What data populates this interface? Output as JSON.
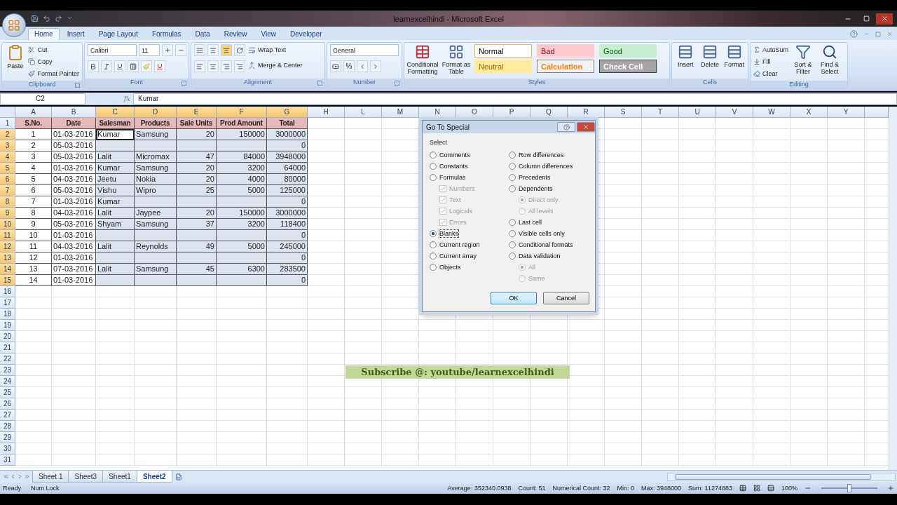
{
  "window": {
    "title": "learnexcelhindi - Microsoft Excel"
  },
  "ribbon_tabs": [
    {
      "label": "Home",
      "selected": true
    },
    {
      "label": "Insert",
      "selected": false
    },
    {
      "label": "Page Layout",
      "selected": false
    },
    {
      "label": "Formulas",
      "selected": false
    },
    {
      "label": "Data",
      "selected": false
    },
    {
      "label": "Review",
      "selected": false
    },
    {
      "label": "View",
      "selected": false
    },
    {
      "label": "Developer",
      "selected": false
    }
  ],
  "clipboard": {
    "title": "Clipboard",
    "paste": "Paste",
    "items": [
      "Cut",
      "Copy",
      "Format Painter"
    ]
  },
  "font": {
    "title": "Font",
    "font_name": "Calibri",
    "font_size": "11"
  },
  "alignment": {
    "title": "Alignment",
    "wrap": "Wrap Text",
    "merge": "Merge & Center"
  },
  "number": {
    "title": "Number",
    "format": "General",
    "percent": "%"
  },
  "styles": {
    "title": "Styles",
    "buttons": [
      "Conditional Formatting",
      "Format as Table"
    ],
    "gallery": [
      {
        "label": "Normal",
        "kind": "normal"
      },
      {
        "label": "Bad",
        "kind": "bad"
      },
      {
        "label": "Good",
        "kind": "good"
      },
      {
        "label": "Neutral",
        "kind": "neutral"
      },
      {
        "label": "Calculation",
        "kind": "calculation"
      },
      {
        "label": "Check Cell",
        "kind": "check"
      }
    ]
  },
  "cells": {
    "title": "Cells",
    "buttons": [
      "Insert",
      "Delete",
      "Format"
    ]
  },
  "editing": {
    "title": "Editing",
    "items": [
      "AutoSum",
      "Fill",
      "Clear"
    ],
    "buttons": [
      "Sort & Filter",
      "Find & Select"
    ]
  },
  "formula_bar": {
    "name_box": "C2",
    "function_label": "fx",
    "formula": "Kumar"
  },
  "columns": [
    {
      "label": "A",
      "selected": false
    },
    {
      "label": "B",
      "selected": false
    },
    {
      "label": "C",
      "selected": true
    },
    {
      "label": "D",
      "selected": true
    },
    {
      "label": "E",
      "selected": true
    },
    {
      "label": "F",
      "selected": true
    },
    {
      "label": "G",
      "selected": true
    },
    {
      "label": "H",
      "selected": false
    },
    {
      "label": "L",
      "selected": false
    },
    {
      "label": "M",
      "selected": false
    },
    {
      "label": "N",
      "selected": false
    },
    {
      "label": "O",
      "selected": false
    },
    {
      "label": "P",
      "selected": false
    },
    {
      "label": "Q",
      "selected": false
    },
    {
      "label": "R",
      "selected": false
    },
    {
      "label": "S",
      "selected": false
    },
    {
      "label": "T",
      "selected": false
    },
    {
      "label": "U",
      "selected": false
    },
    {
      "label": "V",
      "selected": false
    },
    {
      "label": "W",
      "selected": false
    },
    {
      "label": "X",
      "selected": false
    },
    {
      "label": "Y",
      "selected": false
    }
  ],
  "rows": [
    {
      "number": "1",
      "kind": "header",
      "selected": false,
      "cells": {
        "A": "S.No.",
        "B": "Date",
        "C": "Salesman",
        "D": "Products",
        "E": "Sale Units",
        "F": "Prod Amount",
        "G": "Total"
      }
    },
    {
      "number": "2",
      "kind": "data",
      "selected": true,
      "cells": {
        "A": "1",
        "B": "01-03-2016",
        "C": "Kumar",
        "D": "Samsung",
        "E": "20",
        "F": "150000",
        "G": "3000000"
      }
    },
    {
      "number": "3",
      "kind": "data",
      "selected": true,
      "cells": {
        "A": "2",
        "B": "05-03-2016",
        "G": "0"
      }
    },
    {
      "number": "4",
      "kind": "data",
      "selected": true,
      "cells": {
        "A": "3",
        "B": "05-03-2016",
        "C": "Lalit",
        "D": "Micromax",
        "E": "47",
        "F": "84000",
        "G": "3948000"
      }
    },
    {
      "number": "5",
      "kind": "data",
      "selected": true,
      "cells": {
        "A": "4",
        "B": "01-03-2016",
        "C": "Kumar",
        "D": "Samsung",
        "E": "20",
        "F": "3200",
        "G": "64000"
      }
    },
    {
      "number": "6",
      "kind": "data",
      "selected": true,
      "cells": {
        "A": "5",
        "B": "04-03-2016",
        "C": "Jeetu",
        "D": "Nokia",
        "E": "20",
        "F": "4000",
        "G": "80000"
      }
    },
    {
      "number": "7",
      "kind": "data",
      "selected": true,
      "cells": {
        "A": "6",
        "B": "05-03-2016",
        "C": "Vishu",
        "D": "Wipro",
        "E": "25",
        "F": "5000",
        "G": "125000"
      }
    },
    {
      "number": "8",
      "kind": "data",
      "selected": true,
      "cells": {
        "A": "7",
        "B": "01-03-2016",
        "C": "Kumar",
        "G": "0"
      }
    },
    {
      "number": "9",
      "kind": "data",
      "selected": true,
      "cells": {
        "A": "8",
        "B": "04-03-2016",
        "C": "Lalit",
        "D": "Jaypee",
        "E": "20",
        "F": "150000",
        "G": "3000000"
      }
    },
    {
      "number": "10",
      "kind": "data",
      "selected": true,
      "cells": {
        "A": "9",
        "B": "05-03-2016",
        "C": "Shyam",
        "D": "Samsung",
        "E": "37",
        "F": "3200",
        "G": "118400"
      }
    },
    {
      "number": "11",
      "kind": "data",
      "selected": true,
      "cells": {
        "A": "10",
        "B": "01-03-2016",
        "G": "0"
      }
    },
    {
      "number": "12",
      "kind": "data",
      "selected": true,
      "cells": {
        "A": "11",
        "B": "04-03-2016",
        "C": "Lalit",
        "D": "Reynolds",
        "E": "49",
        "F": "5000",
        "G": "245000"
      }
    },
    {
      "number": "13",
      "kind": "data",
      "selected": true,
      "cells": {
        "A": "12",
        "B": "01-03-2016",
        "G": "0"
      }
    },
    {
      "number": "14",
      "kind": "data",
      "selected": true,
      "cells": {
        "A": "13",
        "B": "07-03-2016",
        "C": "Lalit",
        "D": "Samsung",
        "E": "45",
        "F": "6300",
        "G": "283500"
      }
    },
    {
      "number": "15",
      "kind": "data",
      "selected": true,
      "cells": {
        "A": "14",
        "B": "01-03-2016",
        "G": "0"
      }
    },
    {
      "number": "16",
      "kind": "blank",
      "selected": false,
      "cells": {}
    },
    {
      "number": "17",
      "kind": "blank",
      "selected": false,
      "cells": {}
    },
    {
      "number": "18",
      "kind": "blank",
      "selected": false,
      "cells": {}
    },
    {
      "number": "19",
      "kind": "blank",
      "selected": false,
      "cells": {}
    },
    {
      "number": "20",
      "kind": "blank",
      "selected": false,
      "cells": {}
    },
    {
      "number": "21",
      "kind": "blank",
      "selected": false,
      "cells": {}
    },
    {
      "number": "22",
      "kind": "blank",
      "selected": false,
      "cells": {}
    },
    {
      "number": "23",
      "kind": "blank",
      "selected": false,
      "cells": {}
    },
    {
      "number": "24",
      "kind": "blank",
      "selected": false,
      "cells": {}
    },
    {
      "number": "25",
      "kind": "blank",
      "selected": false,
      "cells": {}
    },
    {
      "number": "26",
      "kind": "blank",
      "selected": false,
      "cells": {}
    },
    {
      "number": "27",
      "kind": "blank",
      "selected": false,
      "cells": {}
    },
    {
      "number": "28",
      "kind": "blank",
      "selected": false,
      "cells": {}
    },
    {
      "number": "29",
      "kind": "blank",
      "selected": false,
      "cells": {}
    },
    {
      "number": "30",
      "kind": "blank",
      "selected": false,
      "cells": {}
    },
    {
      "number": "31",
      "kind": "blank",
      "selected": false,
      "cells": {}
    }
  ],
  "banner": {
    "text": "Subscribe @: youtube/learnexcelhindi"
  },
  "dialog": {
    "title": "Go To Special",
    "group": "Select",
    "left": [
      {
        "kind": "radio",
        "label": "Comments",
        "selected": false
      },
      {
        "kind": "radio",
        "label": "Constants",
        "selected": false
      },
      {
        "kind": "radio",
        "label": "Formulas",
        "selected": false,
        "children": [
          {
            "kind": "checkbox",
            "label": "Numbers",
            "checked": true,
            "disabled": true
          },
          {
            "kind": "checkbox",
            "label": "Text",
            "checked": true,
            "disabled": true
          },
          {
            "kind": "checkbox",
            "label": "Logicals",
            "checked": true,
            "disabled": true
          },
          {
            "kind": "checkbox",
            "label": "Errors",
            "checked": true,
            "disabled": true
          }
        ]
      },
      {
        "kind": "radio",
        "label": "Blanks",
        "selected": true
      },
      {
        "kind": "radio",
        "label": "Current region",
        "selected": false
      },
      {
        "kind": "radio",
        "label": "Current array",
        "selected": false
      },
      {
        "kind": "radio",
        "label": "Objects",
        "selected": false
      }
    ],
    "right": [
      {
        "kind": "radio",
        "label": "Row differences",
        "selected": false
      },
      {
        "kind": "radio",
        "label": "Column differences",
        "selected": false
      },
      {
        "kind": "radio",
        "label": "Precedents",
        "selected": false
      },
      {
        "kind": "radio",
        "label": "Dependents",
        "selected": false,
        "children": [
          {
            "kind": "radio",
            "label": "Direct only",
            "selected": true,
            "disabled": true
          },
          {
            "kind": "radio",
            "label": "All levels",
            "selected": false,
            "disabled": true
          }
        ]
      },
      {
        "kind": "radio",
        "label": "Last cell",
        "selected": false
      },
      {
        "kind": "radio",
        "label": "Visible cells only",
        "selected": false
      },
      {
        "kind": "radio",
        "label": "Conditional formats",
        "selected": false
      },
      {
        "kind": "radio",
        "label": "Data validation",
        "selected": false,
        "children": [
          {
            "kind": "radio",
            "label": "All",
            "selected": true,
            "disabled": true
          },
          {
            "kind": "radio",
            "label": "Same",
            "selected": false,
            "disabled": true
          }
        ]
      }
    ],
    "buttons": [
      "OK",
      "Cancel"
    ]
  },
  "sheet_tabs": [
    {
      "label": "Sheet 1",
      "selected": false
    },
    {
      "label": "Sheet3",
      "selected": false
    },
    {
      "label": "Sheet1",
      "selected": false
    },
    {
      "label": "Sheet2",
      "selected": true
    }
  ],
  "status_bar": {
    "mode": "Ready",
    "num_lock": "Num Lock",
    "stats": [
      "Average: 352340.0938",
      "Count: 51",
      "Numerical Count: 32",
      "Min: 0",
      "Max: 3948000",
      "Sum: 11274883"
    ],
    "zoom": {
      "reading": "100%",
      "level": 0.5
    }
  }
}
